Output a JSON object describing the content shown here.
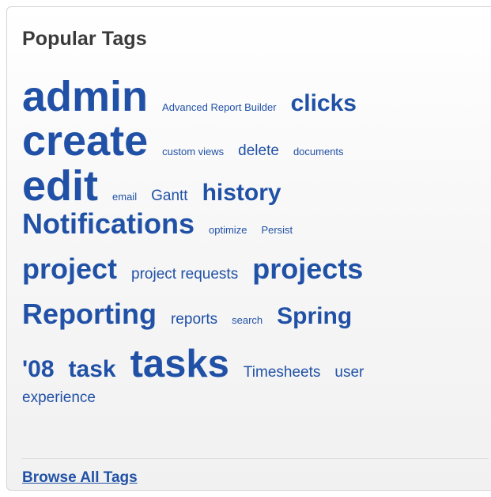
{
  "panel": {
    "title": "Popular Tags",
    "browse_label": "Browse All Tags"
  },
  "tags": {
    "admin": "admin",
    "advanced_report_builder": "Advanced Report Builder",
    "clicks": "clicks",
    "create": "create",
    "custom_views": "custom views",
    "delete": "delete",
    "documents": "documents",
    "edit": "edit",
    "email": "email",
    "gantt": "Gantt",
    "history": "history",
    "notifications": "Notifications",
    "optimize": "optimize",
    "persist": "Persist",
    "project": "project",
    "project_requests": "project requests",
    "projects": "projects",
    "reporting": "Reporting",
    "reports": "reports",
    "search": "search",
    "spring": "Spring",
    "08": "'08",
    "task": "task",
    "tasks": "tasks",
    "timesheets": "Timesheets",
    "user": "user",
    "experience": "experience"
  },
  "colors": {
    "tag_color": "#2151a6",
    "title_color": "#3a3a3a"
  }
}
